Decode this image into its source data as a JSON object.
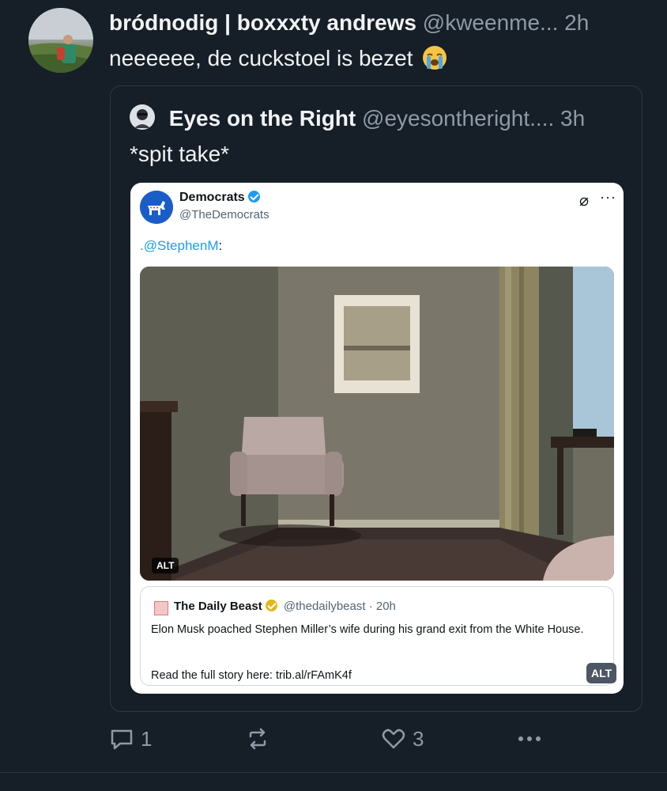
{
  "post": {
    "author_name": "bródnodig | boxxxty andrews",
    "handle": "@kweenme...",
    "time": "2h",
    "text": "neeeeee, de cuckstoel is bezet"
  },
  "quote": {
    "author_name": "Eyes on the Right",
    "handle": "@eyesontheright....",
    "time": "3h",
    "text": "*spit take*"
  },
  "embedded_tweet": {
    "name": "Democrats",
    "handle": "@TheDemocrats",
    "mention": ".@StephenM",
    "mention_suffix": ":",
    "photo_alt_badge": "ALT",
    "link_card": {
      "source_name": "The Daily Beast",
      "source_handle": "@thedailybeast",
      "source_time": "· 20h",
      "body": "Elon Musk poached Stephen Miller’s wife during his grand exit from the White House.",
      "link_text": "Read the full story here: trib.al/rFAmK4f",
      "alt_badge": "ALT"
    }
  },
  "actions": {
    "reply_count": "1",
    "like_count": "3"
  },
  "colors": {
    "background": "#161e27",
    "secondary_text": "#8d9aa8",
    "link_blue": "#1d9bf0",
    "democrats_blue": "#1a5dc8"
  },
  "icons": [
    "reply-icon",
    "repost-icon",
    "like-icon",
    "more-icon",
    "verified-icon",
    "grok-icon"
  ]
}
